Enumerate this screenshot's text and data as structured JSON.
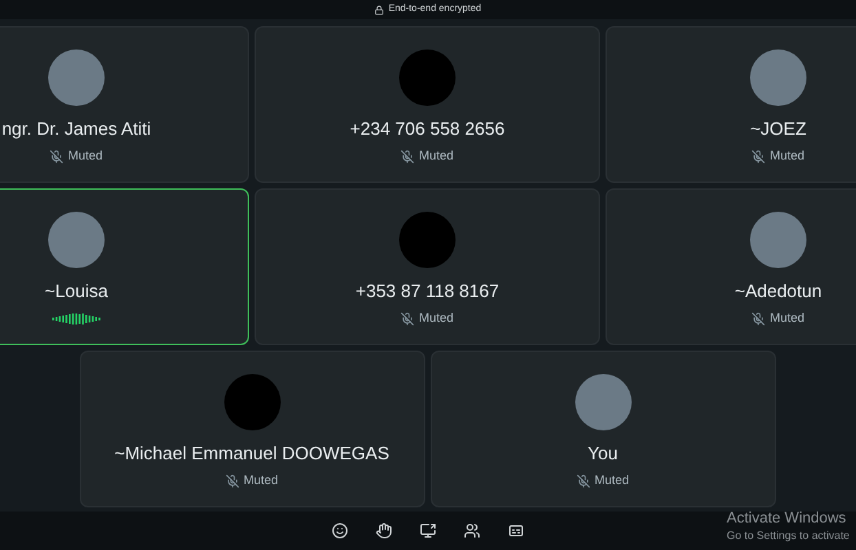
{
  "header": {
    "label": "End-to-end encrypted"
  },
  "rows": [
    {
      "tiles": [
        {
          "name": "ngr. Dr. James Atiti",
          "kind": "photo",
          "speaking": false,
          "muted": true,
          "status": "Muted"
        },
        {
          "name": "+234 706 558 2656",
          "kind": "blank",
          "speaking": false,
          "muted": true,
          "status": "Muted"
        },
        {
          "name": "~JOEZ",
          "kind": "photo",
          "speaking": false,
          "muted": true,
          "status": "Muted"
        }
      ]
    },
    {
      "tiles": [
        {
          "name": "~Louisa",
          "kind": "photo",
          "speaking": true,
          "muted": false
        },
        {
          "name": "+353 87 118 8167",
          "kind": "blank",
          "speaking": false,
          "muted": true,
          "status": "Muted"
        },
        {
          "name": "~Adedotun",
          "kind": "photo",
          "speaking": false,
          "muted": true,
          "status": "Muted"
        }
      ]
    },
    {
      "tiles": [
        {
          "name": "~Michael Emmanuel DOOWEGAS",
          "kind": "blank",
          "speaking": false,
          "muted": true,
          "status": "Muted"
        },
        {
          "name": "You",
          "kind": "photo",
          "speaking": false,
          "muted": true,
          "status": "Muted"
        }
      ]
    }
  ],
  "toolbar": [
    {
      "kind": "emoji"
    },
    {
      "kind": "hand"
    },
    {
      "kind": "share"
    },
    {
      "kind": "people"
    },
    {
      "kind": "captions"
    }
  ],
  "os_overlay": {
    "title": "Activate Windows",
    "subtitle": "Go to Settings to activate"
  }
}
